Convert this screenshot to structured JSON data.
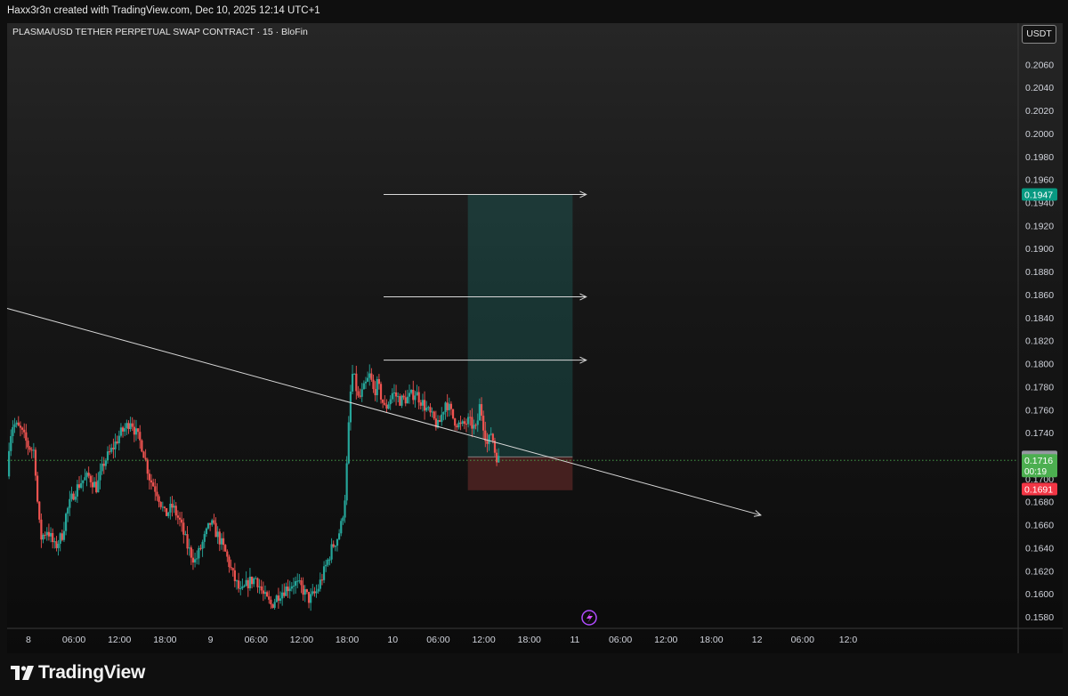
{
  "header": {
    "caption": "Haxx3r3n created with TradingView.com, Dec 10, 2025 12:14 UTC+1",
    "symbol_title": "PLASMA/USD TETHER PERPETUAL SWAP CONTRACT · 15 · BloFin",
    "currency": "USDT"
  },
  "footer": {
    "logo_text": "TradingView"
  },
  "colors": {
    "up": "#26a69a",
    "down": "#ef5350",
    "green_badge": "#4caf50",
    "teal_badge": "#089981",
    "red_badge": "#f23645",
    "grey_badge": "#9598a1"
  },
  "chart_data": {
    "type": "candlestick",
    "symbol": "PLASMA/USD TETHER PERPETUAL SWAP CONTRACT",
    "interval": "15",
    "exchange": "BloFin",
    "y_axis": {
      "range": [
        0.157,
        0.2085
      ],
      "ticks": [
        "0.2060",
        "0.2040",
        "0.2020",
        "0.2000",
        "0.1980",
        "0.1960",
        "0.1940",
        "0.1920",
        "0.1900",
        "0.1880",
        "0.1860",
        "0.1840",
        "0.1820",
        "0.1800",
        "0.1780",
        "0.1760",
        "0.1740",
        "0.1720",
        "0.1700",
        "0.1680",
        "0.1660",
        "0.1640",
        "0.1620",
        "0.1600",
        "0.1580"
      ]
    },
    "x_axis": {
      "range_hours": [
        -2.8,
        130.4
      ],
      "ticks": [
        {
          "h": 0,
          "label": "8"
        },
        {
          "h": 6,
          "label": "06:00"
        },
        {
          "h": 12,
          "label": "12:00"
        },
        {
          "h": 18,
          "label": "18:00"
        },
        {
          "h": 24,
          "label": "9"
        },
        {
          "h": 30,
          "label": "06:00"
        },
        {
          "h": 36,
          "label": "12:00"
        },
        {
          "h": 42,
          "label": "18:00"
        },
        {
          "h": 48,
          "label": "10"
        },
        {
          "h": 54,
          "label": "06:00"
        },
        {
          "h": 60,
          "label": "12:00"
        },
        {
          "h": 66,
          "label": "18:00"
        },
        {
          "h": 72,
          "label": "11"
        },
        {
          "h": 78,
          "label": "06:00"
        },
        {
          "h": 84,
          "label": "12:00"
        },
        {
          "h": 90,
          "label": "18:00"
        },
        {
          "h": 96,
          "label": "12"
        },
        {
          "h": 102,
          "label": "06:00"
        },
        {
          "h": 108,
          "label": "12:0"
        }
      ]
    },
    "price_path": [
      [
        -2.8,
        0.1702
      ],
      [
        -2.5,
        0.1735
      ],
      [
        -2.0,
        0.1748
      ],
      [
        -1.0,
        0.1742
      ],
      [
        0,
        0.1728
      ],
      [
        0.8,
        0.1724
      ],
      [
        1.2,
        0.168
      ],
      [
        1.6,
        0.1648
      ],
      [
        2.5,
        0.1656
      ],
      [
        3.5,
        0.164
      ],
      [
        4.5,
        0.1652
      ],
      [
        5.0,
        0.167
      ],
      [
        6.0,
        0.1688
      ],
      [
        7.0,
        0.1698
      ],
      [
        8.0,
        0.1702
      ],
      [
        9.0,
        0.1692
      ],
      [
        10.0,
        0.1715
      ],
      [
        11.0,
        0.1725
      ],
      [
        12.0,
        0.1738
      ],
      [
        13.0,
        0.1746
      ],
      [
        13.5,
        0.1752
      ],
      [
        14.0,
        0.1742
      ],
      [
        15.0,
        0.1728
      ],
      [
        16.0,
        0.17
      ],
      [
        17.0,
        0.1688
      ],
      [
        18.0,
        0.1668
      ],
      [
        19.0,
        0.1676
      ],
      [
        20.0,
        0.1662
      ],
      [
        21.0,
        0.164
      ],
      [
        22.0,
        0.1628
      ],
      [
        23.0,
        0.1645
      ],
      [
        24.0,
        0.1662
      ],
      [
        25.0,
        0.165
      ],
      [
        26.0,
        0.1635
      ],
      [
        27.0,
        0.1615
      ],
      [
        28.0,
        0.16
      ],
      [
        29.0,
        0.161
      ],
      [
        30.0,
        0.1614
      ],
      [
        31.0,
        0.1598
      ],
      [
        32.0,
        0.159
      ],
      [
        33.0,
        0.16
      ],
      [
        34.0,
        0.1605
      ],
      [
        35.0,
        0.161
      ],
      [
        36.0,
        0.1605
      ],
      [
        37.0,
        0.1595
      ],
      [
        38.0,
        0.1602
      ],
      [
        39.0,
        0.162
      ],
      [
        40.0,
        0.164
      ],
      [
        40.8,
        0.165
      ],
      [
        41.3,
        0.1662
      ],
      [
        41.8,
        0.169
      ],
      [
        42.2,
        0.1745
      ],
      [
        42.6,
        0.1792
      ],
      [
        43.0,
        0.1785
      ],
      [
        43.5,
        0.1768
      ],
      [
        44.0,
        0.1775
      ],
      [
        45.0,
        0.179
      ],
      [
        45.5,
        0.1775
      ],
      [
        46.0,
        0.1782
      ],
      [
        47.0,
        0.176
      ],
      [
        48.0,
        0.1775
      ],
      [
        49.0,
        0.1768
      ],
      [
        50.0,
        0.177
      ],
      [
        51.0,
        0.1775
      ],
      [
        52.0,
        0.1765
      ],
      [
        53.0,
        0.1755
      ],
      [
        54.0,
        0.1745
      ],
      [
        55.0,
        0.1768
      ],
      [
        56.0,
        0.1752
      ],
      [
        57.0,
        0.1745
      ],
      [
        58.0,
        0.175
      ],
      [
        59.0,
        0.1742
      ],
      [
        59.5,
        0.1765
      ],
      [
        60.0,
        0.1745
      ],
      [
        60.5,
        0.1728
      ],
      [
        61.0,
        0.1742
      ],
      [
        61.5,
        0.1722
      ],
      [
        62.0,
        0.1716
      ]
    ],
    "trendline": {
      "from": [
        -2.8,
        0.1848
      ],
      "to": [
        58.0,
        0.1738
      ],
      "extends_to_h": 96.5
    },
    "projection_arrows": [
      {
        "from_h": 46.8,
        "to_h": 73.5,
        "price": 0.1947
      },
      {
        "from_h": 46.8,
        "to_h": 73.5,
        "price": 0.1858
      },
      {
        "from_h": 46.8,
        "to_h": 73.5,
        "price": 0.1803
      }
    ],
    "long_position": {
      "from_h": 57.9,
      "to_h": 71.7,
      "entry": 0.1719,
      "take_profit": 0.1947,
      "stop_loss": 0.1691,
      "stop_bottom": 0.169
    },
    "last_price": 0.1716,
    "price_labels": [
      {
        "value": "0.1947",
        "price": 0.1947,
        "color": "#089981"
      },
      {
        "value": "0.1719",
        "price": 0.1719,
        "color": "#9598a1"
      },
      {
        "value": "0.1716",
        "sub": "00:19",
        "price": 0.1716,
        "color": "#4caf50"
      },
      {
        "value": "0.1691",
        "price": 0.1691,
        "color": "#f23645"
      }
    ]
  }
}
